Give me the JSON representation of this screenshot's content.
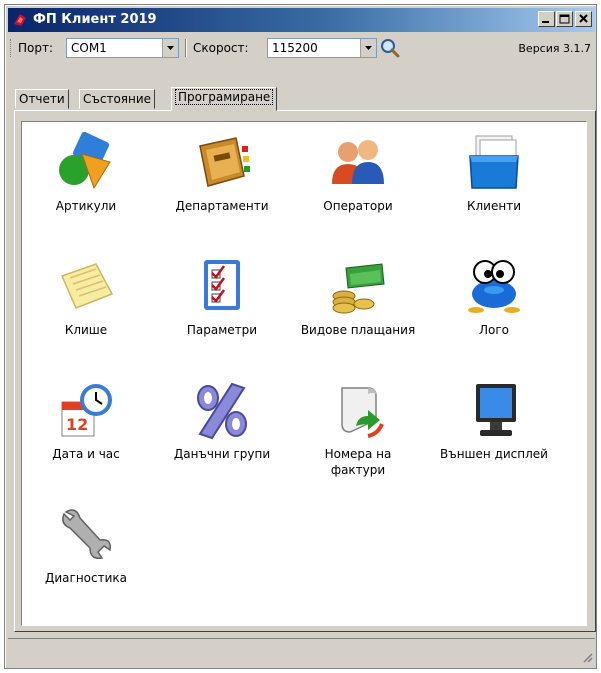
{
  "window": {
    "title": "ФП Клиент 2019",
    "title_color": "#0a246a",
    "icon": "fiscal-printer-icon"
  },
  "toolbar": {
    "port_label": "Порт:",
    "port_value": "COM1",
    "speed_label": "Скорост:",
    "speed_value": "115200",
    "search_icon": "search-icon",
    "version": "Версия 3.1.7"
  },
  "tabs": [
    {
      "label": "Отчети",
      "active": false
    },
    {
      "label": "Състояние",
      "active": false
    },
    {
      "label": "Програмиране",
      "active": true
    }
  ],
  "items": [
    {
      "label": "Артикули",
      "icon": "articles-icon"
    },
    {
      "label": "Департаменти",
      "icon": "departments-icon"
    },
    {
      "label": "Оператори",
      "icon": "operators-icon"
    },
    {
      "label": "Клиенти",
      "icon": "clients-icon"
    },
    {
      "label": "Клише",
      "icon": "cliche-icon"
    },
    {
      "label": "Параметри",
      "icon": "parameters-icon"
    },
    {
      "label": "Видове плащания",
      "icon": "payment-types-icon"
    },
    {
      "label": "Лого",
      "icon": "logo-icon"
    },
    {
      "label": "Дата и час",
      "icon": "date-time-icon"
    },
    {
      "label": "Данъчни групи",
      "icon": "tax-groups-icon"
    },
    {
      "label": "Номера на фактури",
      "icon": "invoice-numbers-icon"
    },
    {
      "label": "Външен дисплей",
      "icon": "external-display-icon"
    },
    {
      "label": "Диагностика",
      "icon": "diagnostics-icon"
    }
  ]
}
